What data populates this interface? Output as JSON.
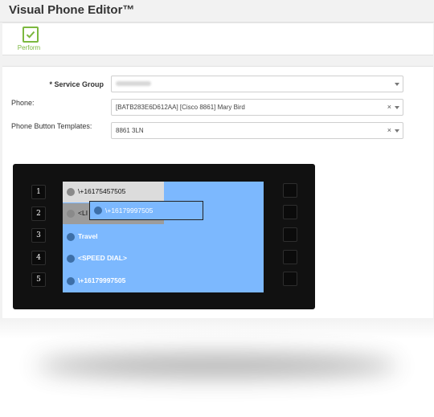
{
  "header": {
    "title": "Visual Phone Editor™"
  },
  "toolbar": {
    "perform_label": "Perform",
    "perform_icon": "checkmark-icon",
    "accent": "#7cb83f"
  },
  "form": {
    "service_group": {
      "label": "* Service Group",
      "value_redacted": true
    },
    "phone": {
      "label": "Phone:",
      "value": "[BATB283E6D612AA] [Cisco 8861] Mary Bird"
    },
    "template": {
      "label": "Phone Button Templates:",
      "value": "8861 3LN"
    },
    "clear_glyph": "×"
  },
  "phone_display": {
    "left_buttons": [
      "1",
      "2",
      "3",
      "4",
      "5"
    ],
    "lines": [
      {
        "text": "\\+16175457505",
        "icon": "handset-icon",
        "style": "gray1"
      },
      {
        "text": "<LI",
        "icon": "handset-icon",
        "style": "gray2"
      },
      {
        "text": "Travel",
        "icon": "speaker-icon",
        "style": "blue"
      },
      {
        "text": "<SPEED DIAL>",
        "icon": "speaker-icon",
        "style": "blue"
      },
      {
        "text": "\\+16179997505",
        "icon": "handset-icon",
        "style": "blue"
      }
    ],
    "drag_item": {
      "text": "\\+16179997505",
      "icon": "handset-icon"
    },
    "screen_color": "#7cb8fe"
  }
}
